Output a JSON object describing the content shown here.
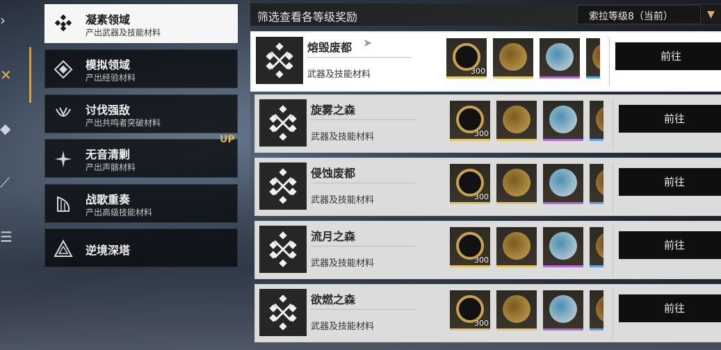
{
  "header": {
    "title": "筛选查看各等级奖励",
    "level_select": "索拉等级8（当前）"
  },
  "rail": {
    "icons": [
      "chevron-right-icon",
      "crossed-swords-icon",
      "diamond-icon",
      "claw-icon",
      "menu-icon"
    ]
  },
  "categories": [
    {
      "title": "凝素领域",
      "subtitle": "产出武器及技能材料",
      "icon": "forgery-icon",
      "active": true
    },
    {
      "title": "模拟领域",
      "subtitle": "产出经验材料",
      "icon": "simulation-icon"
    },
    {
      "title": "讨伐强敌",
      "subtitle": "产出共鸣者突破材料",
      "icon": "boss-icon"
    },
    {
      "title": "无音清剿",
      "subtitle": "产出声骸材料",
      "icon": "sparkle-icon"
    },
    {
      "title": "战歌重奏",
      "subtitle": "产出高级技能材料",
      "icon": "harp-icon"
    },
    {
      "title": "逆境深塔",
      "subtitle": "",
      "icon": "tower-icon"
    }
  ],
  "up_badge": "UP",
  "domains": [
    {
      "name": "熔毁废都",
      "subtitle": "武器及技能材料",
      "reward_qty": "300",
      "go_label": "前往"
    },
    {
      "name": "旋雾之森",
      "subtitle": "武器及技能材料",
      "reward_qty": "300",
      "go_label": "前往"
    },
    {
      "name": "侵蚀废都",
      "subtitle": "武器及技能材料",
      "reward_qty": "300",
      "go_label": "前往"
    },
    {
      "name": "流月之森",
      "subtitle": "武器及技能材料",
      "reward_qty": "300",
      "go_label": "前往"
    },
    {
      "name": "欲燃之森",
      "subtitle": "武器及技能材料",
      "reward_qty": "300",
      "go_label": "前往"
    }
  ],
  "colors": {
    "accent": "#d9b36a",
    "stripe_gold": "#e0c56a",
    "stripe_purple": "#b06ad9",
    "stripe_blue": "#5aa6e6"
  }
}
